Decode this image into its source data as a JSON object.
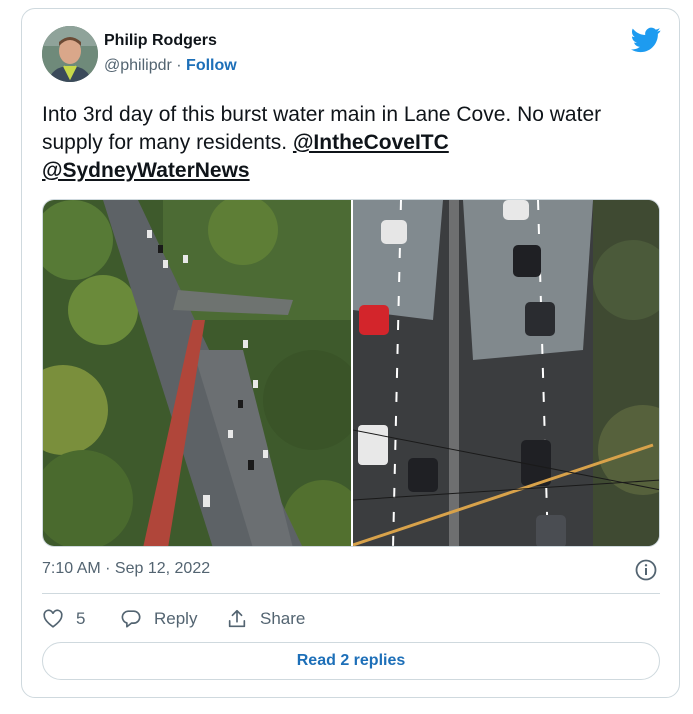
{
  "tweet": {
    "author": {
      "name": "Philip Rodgers",
      "handle": "@philipdr",
      "separator": " · ",
      "follow_label": "Follow"
    },
    "text": {
      "body": "Into 3rd day of this burst water main in Lane Cove. No water supply for many residents. ",
      "mention_1": "@IntheCoveITC",
      "mention_2": "@SydneyWaterNews"
    },
    "timestamp": "7:10 AM · Sep 12, 2022",
    "actions": {
      "like_count": "5",
      "reply_label": "Reply",
      "share_label": "Share"
    },
    "read_replies_label": "Read 2 replies"
  },
  "icons": {
    "twitter": "twitter-bird-icon",
    "info": "info-icon",
    "like": "heart-icon",
    "reply": "reply-icon",
    "share": "share-icon"
  },
  "colors": {
    "accent": "#1d9bf0",
    "link": "#1d6fb8",
    "secondary_text": "#536471",
    "border": "#cfd9de"
  }
}
